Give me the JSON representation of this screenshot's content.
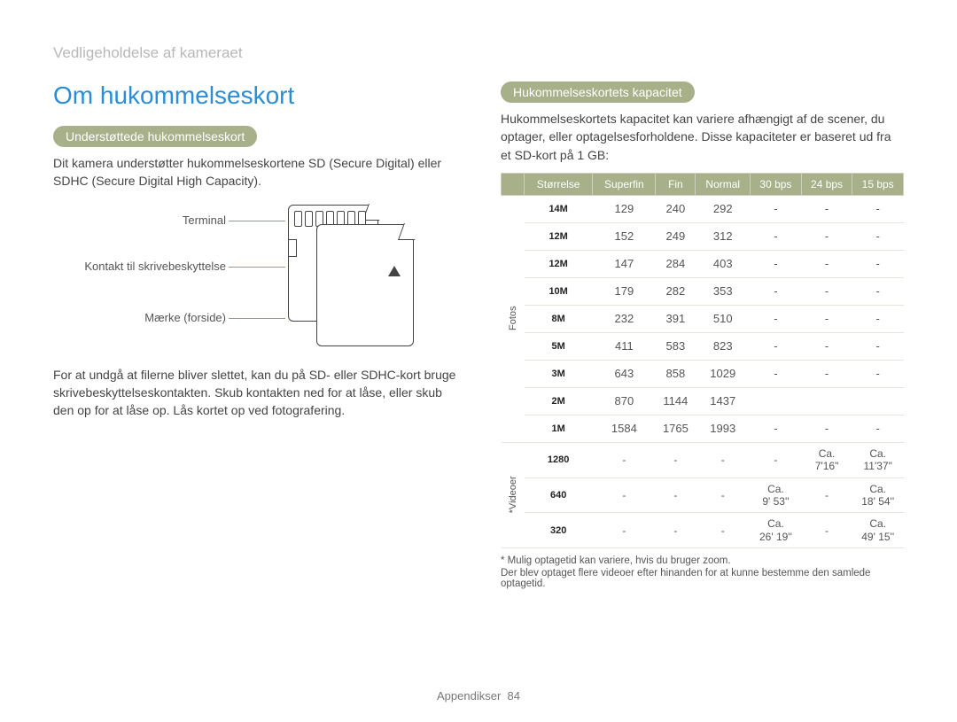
{
  "running_head": "Vedligeholdelse af kameraet",
  "title": "Om hukommelseskort",
  "left": {
    "pill": "Understøttede hukommelseskort",
    "intro": "Dit kamera understøtter hukommelseskortene SD (Secure Digital) eller SDHC (Secure Digital High Capacity).",
    "labels": {
      "terminal": "Terminal",
      "wp": "Kontakt til skrivebeskyttelse",
      "brand": "Mærke (forside)"
    },
    "note": "For at undgå at filerne bliver slettet, kan du på SD- eller SDHC-kort bruge skrivebeskyttelseskontakten. Skub kontakten ned for at låse, eller skub den op for at låse op. Lås kortet op ved fotografering."
  },
  "right": {
    "pill": "Hukommelseskortets kapacitet",
    "intro": "Hukommelseskortets kapacitet kan variere afhængigt af de scener, du optager, eller optagelsesforholdene. Disse kapaciteter er baseret ud fra et SD-kort på 1 GB:",
    "headers": [
      "Størrelse",
      "Superfin",
      "Fin",
      "Normal",
      "30 bps",
      "24 bps",
      "15 bps"
    ],
    "group_photos": "F\no\nt\no\ns",
    "group_video": "*\nV\ni\nd\ne\no\ne\nr",
    "photo_rows": [
      {
        "size": "14M",
        "c": [
          "129",
          "240",
          "292",
          "-",
          "-",
          "-"
        ]
      },
      {
        "size": "12M",
        "c": [
          "152",
          "249",
          "312",
          "-",
          "-",
          "-"
        ]
      },
      {
        "size": "12M",
        "c": [
          "147",
          "284",
          "403",
          "-",
          "-",
          "-"
        ]
      },
      {
        "size": "10M",
        "c": [
          "179",
          "282",
          "353",
          "-",
          "-",
          "-"
        ]
      },
      {
        "size": "8M",
        "c": [
          "232",
          "391",
          "510",
          "-",
          "-",
          "-"
        ]
      },
      {
        "size": "5M",
        "c": [
          "411",
          "583",
          "823",
          "-",
          "-",
          "-"
        ]
      },
      {
        "size": "3M",
        "c": [
          "643",
          "858",
          "1029",
          "-",
          "-",
          "-"
        ]
      },
      {
        "size": "2M",
        "c": [
          "870",
          "1144",
          "1437",
          "",
          "",
          ""
        ]
      },
      {
        "size": "1M",
        "c": [
          "1584",
          "1765",
          "1993",
          "-",
          "-",
          "-"
        ]
      }
    ],
    "video_rows": [
      {
        "size": "1280",
        "c": [
          "-",
          "-",
          "-",
          "-",
          "Ca. 7'16\"",
          "Ca. 11'37\""
        ]
      },
      {
        "size": "640",
        "c": [
          "-",
          "-",
          "-",
          "Ca. 9' 53''",
          "-",
          "Ca. 18' 54''"
        ]
      },
      {
        "size": "320",
        "c": [
          "-",
          "-",
          "-",
          "Ca. 26' 19''",
          "-",
          "Ca. 49' 15''"
        ]
      }
    ],
    "footnotes": [
      "* Mulig optagetid kan variere, hvis du bruger zoom.",
      "Der blev optaget flere videoer efter hinanden for at kunne bestemme den samlede optagetid."
    ]
  },
  "footer": {
    "section": "Appendikser",
    "page": "84"
  },
  "chart_data": {
    "type": "table",
    "title": "Hukommelseskortets kapacitet (1 GB SD)",
    "columns": [
      "Størrelse",
      "Superfin",
      "Fin",
      "Normal",
      "30 bps",
      "24 bps",
      "15 bps"
    ],
    "rows": [
      [
        "14M",
        129,
        240,
        292,
        null,
        null,
        null
      ],
      [
        "12M",
        152,
        249,
        312,
        null,
        null,
        null
      ],
      [
        "12M",
        147,
        284,
        403,
        null,
        null,
        null
      ],
      [
        "10M",
        179,
        282,
        353,
        null,
        null,
        null
      ],
      [
        "8M",
        232,
        391,
        510,
        null,
        null,
        null
      ],
      [
        "5M",
        411,
        583,
        823,
        null,
        null,
        null
      ],
      [
        "3M",
        643,
        858,
        1029,
        null,
        null,
        null
      ],
      [
        "2M",
        870,
        1144,
        1437,
        null,
        null,
        null
      ],
      [
        "1M",
        1584,
        1765,
        1993,
        null,
        null,
        null
      ],
      [
        "1280",
        null,
        null,
        null,
        null,
        "7'16\"",
        "11'37\""
      ],
      [
        "640",
        null,
        null,
        null,
        "9' 53''",
        null,
        "18' 54''"
      ],
      [
        "320",
        null,
        null,
        null,
        "26' 19''",
        null,
        "49' 15''"
      ]
    ]
  }
}
